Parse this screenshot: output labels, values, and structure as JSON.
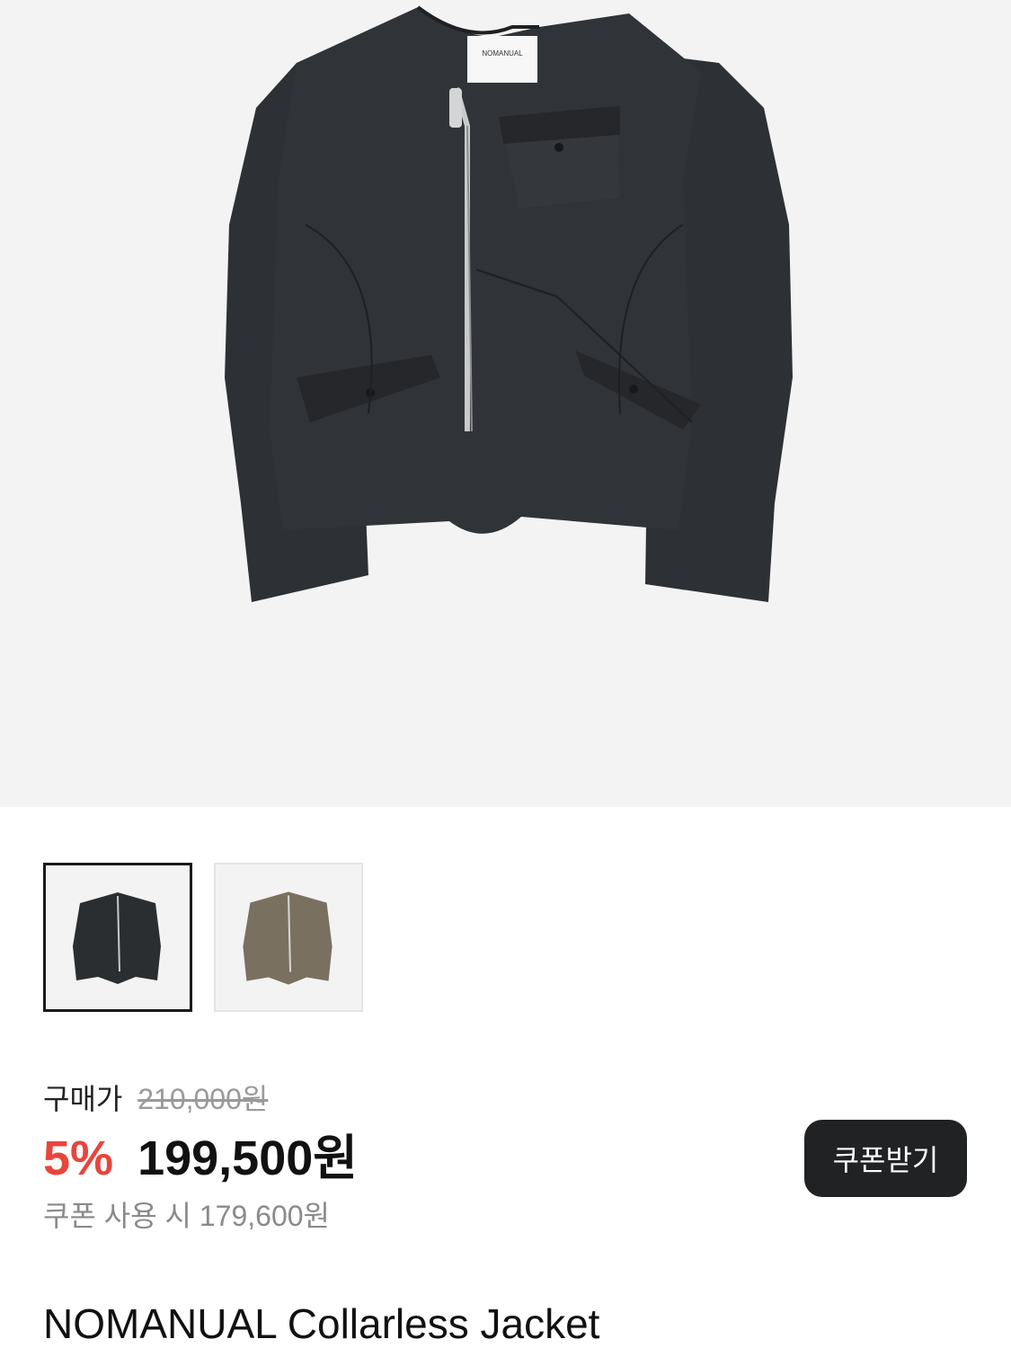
{
  "product": {
    "images": [
      {
        "name": "black-jacket",
        "color": "#2b2e31"
      },
      {
        "name": "olive-jacket",
        "color": "#7a7060"
      }
    ],
    "tag_text": "NOMANUAL",
    "title": "NOMANUAL Collarless Jacket"
  },
  "price": {
    "label": "구매가",
    "original": "210,000원",
    "discount": "5%",
    "sale": "199,500원",
    "coupon_price": "쿠폰 사용 시 179,600원",
    "coupon_button": "쿠폰받기"
  },
  "colors": {
    "accent": "#e8453c",
    "button_bg": "#202224",
    "muted": "#8a8a8a"
  }
}
